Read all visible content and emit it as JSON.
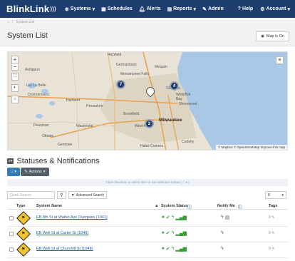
{
  "navbar": {
    "brand": "BlinkLink",
    "items": [
      {
        "label": "Systems",
        "icon": "globe-icon",
        "dropdown": true
      },
      {
        "label": "Schedules",
        "icon": "calendar-icon",
        "dropdown": false
      },
      {
        "label": "Alerts",
        "icon": "bell-icon",
        "dropdown": false
      },
      {
        "label": "Reports",
        "icon": "chart-icon",
        "dropdown": true
      },
      {
        "label": "Admin",
        "icon": "wrench-icon",
        "dropdown": false
      }
    ],
    "help_label": "Help",
    "account_label": "Account"
  },
  "breadcrumb": {
    "current": "System List"
  },
  "page": {
    "title": "System List",
    "map_toggle_label": "Map is On"
  },
  "map": {
    "labels": [
      {
        "text": "Richfield"
      },
      {
        "text": "Germantown"
      },
      {
        "text": "Mequon"
      },
      {
        "text": "Menomonee Falls"
      },
      {
        "text": "Ashippun"
      },
      {
        "text": "Lac La Belle"
      },
      {
        "text": "Oconomowoc"
      },
      {
        "text": "Hartland"
      },
      {
        "text": "Pewaukee"
      },
      {
        "text": "Brookfield"
      },
      {
        "text": "Glendale"
      },
      {
        "text": "Whitefish Bay"
      },
      {
        "text": "Shorewood"
      },
      {
        "text": "Milwaukee"
      },
      {
        "text": "West Allis"
      },
      {
        "text": "Dousman"
      },
      {
        "text": "Waukesha"
      },
      {
        "text": "Ottawa"
      },
      {
        "text": "Genesee"
      },
      {
        "text": "Cudahy"
      },
      {
        "text": "Hales Corners"
      }
    ],
    "clusters": [
      {
        "count": "7"
      },
      {
        "count": "4"
      },
      {
        "count": "2"
      }
    ],
    "attribution": "© Mapbox © OpenStreetMap Improve this map"
  },
  "statuses": {
    "title": "Statuses & Notifications",
    "actions_label": "Actions",
    "hint": "Click checkbox to select item or use selection button ( □ ▾ )",
    "search_placeholder": "Quick Search",
    "advanced_search_label": "Advanced Search",
    "page_size": "8"
  },
  "table": {
    "columns": {
      "type": "Type",
      "name": "System Name",
      "status": "System Status",
      "notify": "Notify Me",
      "tags": "Tags"
    },
    "rows": [
      {
        "name": "EB 8th St at Walter Ave Overpass (1041)"
      },
      {
        "name": "EB Well St at Carter St (1046)"
      },
      {
        "name": "EB Well St at Churchill St (1048)"
      }
    ]
  },
  "colors": {
    "navbar": "#1d3e6e",
    "primary": "#337ab7",
    "status_ok": "#3a9d3a",
    "sign_yellow": "#f4c430",
    "link": "#1a5fa8"
  }
}
